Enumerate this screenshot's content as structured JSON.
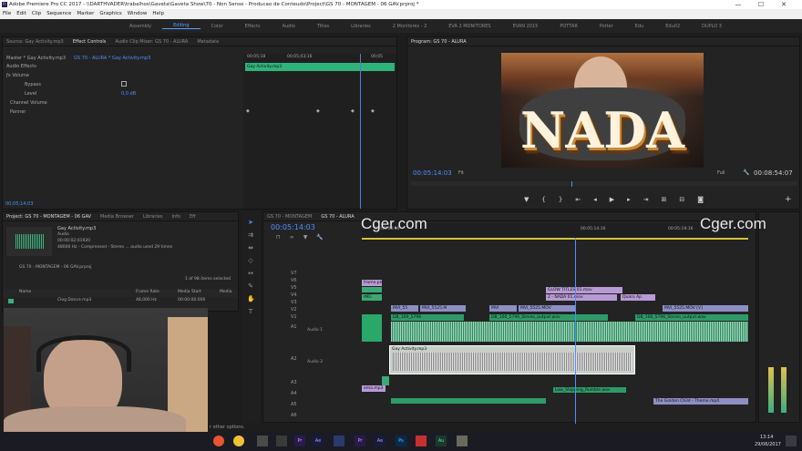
{
  "titlebar": {
    "title": "Adobe Premiere Pro CC 2017 - \\\\DARTHVADER\\trabalhos\\Gaveta\\Gaveta Show\\70 - Non Senso - Producao de Conteudo\\Project\\GS 70 - MONTAGEM - 06 GAV.prproj *",
    "min": "—",
    "max": "☐",
    "close": "✕"
  },
  "menu": [
    "File",
    "Edit",
    "Clip",
    "Sequence",
    "Marker",
    "Graphics",
    "Window",
    "Help"
  ],
  "workspaces": [
    "Assembly",
    "Editing",
    "Color",
    "Effects",
    "Audio",
    "Titles",
    "Libraries",
    "2 Monitores - 2",
    "EVA 2 MONITORES",
    "EVAN 2015",
    "POTTAR",
    "Potter",
    "Edu",
    "Edu02",
    "DUPLO 3"
  ],
  "source": {
    "tabs": [
      "Source: Gay Activity.mp3",
      "Effect Controls",
      "Audio Clip Mixer: GS 70 - ALURA",
      "Metadata"
    ],
    "master": "Master * Gay Activity.mp3",
    "seq": "GS 70 - ALURA * Gay Activity.mp3",
    "section": "Audio Effects",
    "volume": "Volume",
    "bypass": "Bypass",
    "level": "Level",
    "level_val": "0,0 dB",
    "channel": "Channel Volume",
    "panner": "Panner",
    "clip_name": "Gay Activity.mp3",
    "ruler": [
      "00;05;18",
      "00;05;03;16",
      "00;05"
    ],
    "timecode": "00;05;14;03"
  },
  "program": {
    "title": "Program: GS 70 - ALURA",
    "overlay_text": "NADA",
    "timecode": "00:05:14:03",
    "fit": "Fit",
    "full": "Full",
    "duration": "00:08:54:07"
  },
  "project": {
    "tabs": [
      "Project: GS 70 - MONTAGEM - 06 GAV",
      "Media Browser",
      "Libraries",
      "Info",
      "Eff"
    ],
    "file": "Gay Activity.mp3",
    "type": "Audio",
    "dur": "00:00:02:01920",
    "spec": "48000 Hz - Compressed - Stereo ... audio used 29 times",
    "path": "GS 70 - MONTAGEM - 06 GAV.prproj",
    "count": "1 of 98 items selected",
    "headers": [
      "Name",
      "Frame Rate",
      "Media Start",
      "Media"
    ],
    "row": {
      "name": "Clog Dance.mp3",
      "rate": "48,000 Hz",
      "start": "00:00:00:000"
    }
  },
  "timeline": {
    "tabs": [
      "GS 70 - MONTAGEM",
      "GS 70 - ALURA"
    ],
    "timecode": "00:05:14:03",
    "ruler": [
      "00:05:00:16",
      "00:05:14:16",
      "00:05:19:16"
    ],
    "vtracks": [
      "V7",
      "V6",
      "V5",
      "V4",
      "V3",
      "V2",
      "V1"
    ],
    "atracks": [
      "A1",
      "A2",
      "A3",
      "A4",
      "A5",
      "A6"
    ],
    "clips": {
      "v5a": "frame.png",
      "v3a": "GLOW TITLES 01.mov",
      "v2a": "2 - NADA 01.mov",
      "v2b": "Quaro Ap",
      "v2c": "IMG",
      "v1a": "MVI_55",
      "v1b": "MVI_5525.M",
      "v1c": "MVI",
      "v1d": "MVI_5525.MOV",
      "v1e": "MVI_5525.MOV [V]",
      "a1a": "DB_100_5796",
      "a1b": "DB_100_5796_Stereo_output.wav",
      "a1c": "DB_100_5796_Stereo_output.wav",
      "a2": "Gay Activity.mp3",
      "a2l": "Audio 2",
      "a1l": "Audio 1",
      "a4": "Low_Shipping_Rumble.wav",
      "a3": "ema.mp3",
      "a5": "The Golden Child - Theme.mp4"
    }
  },
  "watermark": "Cger.com",
  "taskbar": {
    "time": "13:14",
    "date": "29/06/2017",
    "search": "r other options."
  }
}
